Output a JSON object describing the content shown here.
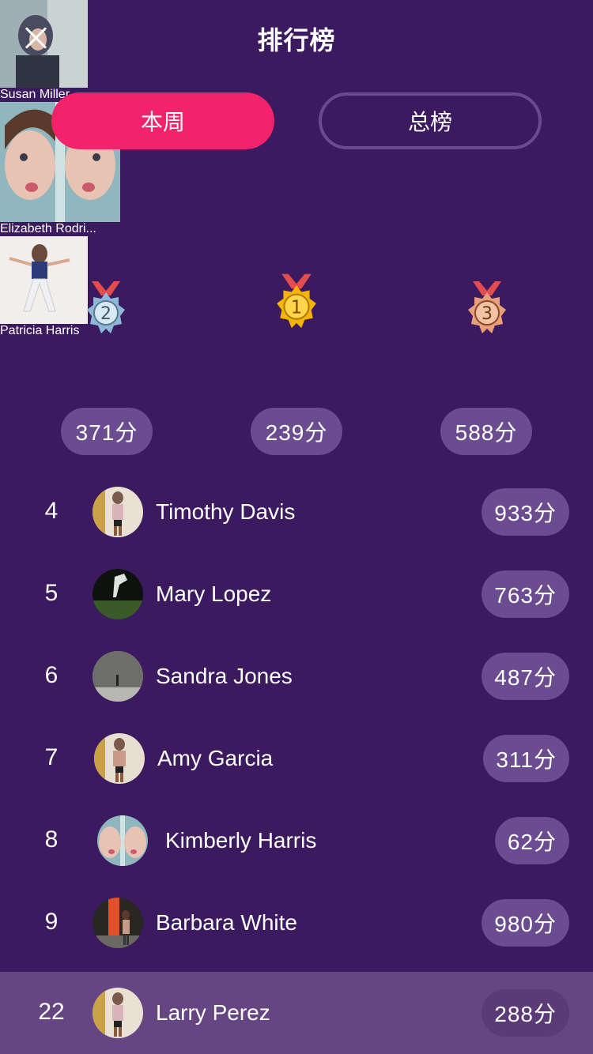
{
  "header": {
    "title": "排行榜",
    "close_icon": "close-icon"
  },
  "tabs": [
    {
      "label": "本周",
      "active": true
    },
    {
      "label": "总榜",
      "active": false
    }
  ],
  "podium": [
    {
      "place": 2,
      "medal_number": "2",
      "name": "Susan Miller",
      "score": "371分",
      "medal_color": "#8fb8d8"
    },
    {
      "place": 1,
      "medal_number": "1",
      "name": "Elizabeth Rodri...",
      "score": "239分",
      "medal_color": "#f5b400"
    },
    {
      "place": 3,
      "medal_number": "3",
      "name": "Patricia Harris",
      "score": "588分",
      "medal_color": "#e7a07a"
    }
  ],
  "list": [
    {
      "rank": "4",
      "name": "Timothy Davis",
      "score": "933分"
    },
    {
      "rank": "5",
      "name": "Mary Lopez",
      "score": "763分"
    },
    {
      "rank": "6",
      "name": "Sandra Jones",
      "score": "487分"
    },
    {
      "rank": "7",
      "name": "Amy Garcia",
      "score": "311分"
    },
    {
      "rank": "8",
      "name": "Kimberly Harris",
      "score": "62分"
    },
    {
      "rank": "9",
      "name": "Barbara White",
      "score": "980分"
    }
  ],
  "me": {
    "rank": "22",
    "name": "Larry Perez",
    "score": "288分"
  },
  "colors": {
    "background": "#3b1a5f",
    "accent": "#f2226b",
    "pill": "#6c4c90",
    "me_row": "#654682"
  }
}
